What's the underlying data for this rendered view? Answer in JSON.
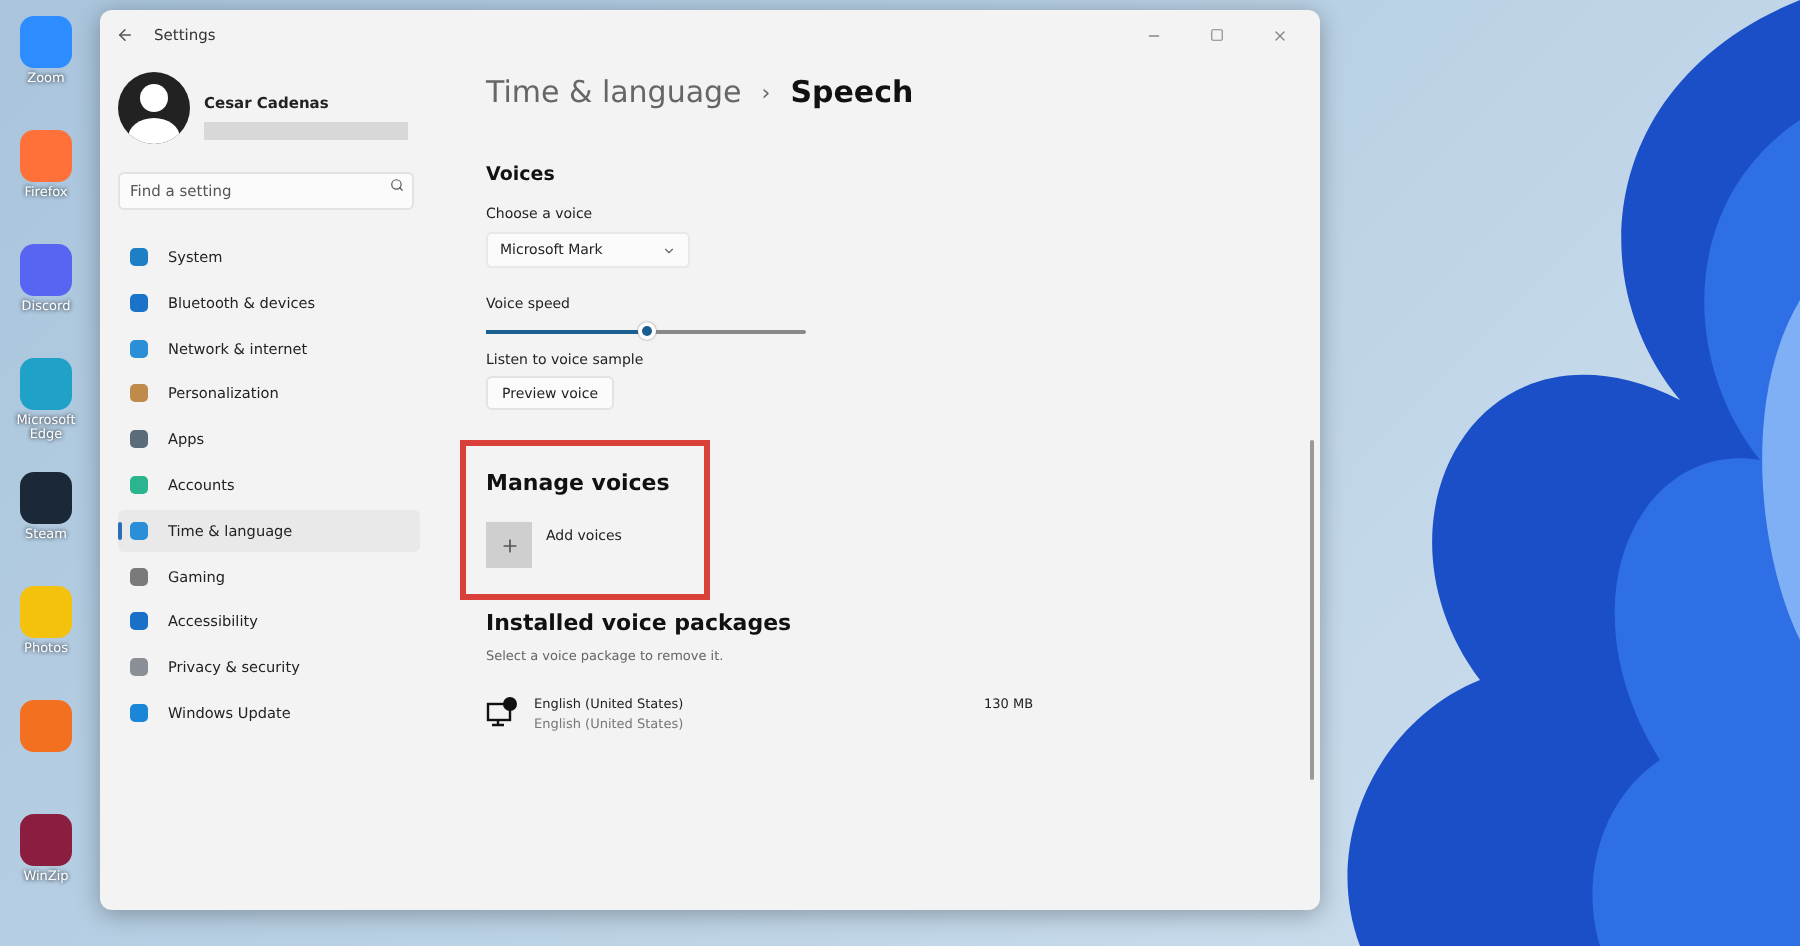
{
  "desktop": {
    "icons": [
      {
        "label": "Zoom",
        "color": "#2d8cff"
      },
      {
        "label": "Firefox",
        "color": "#ff7139"
      },
      {
        "label": "Discord",
        "color": "#5865f2"
      },
      {
        "label": "Microsoft Edge",
        "color": "#1fa1c8"
      },
      {
        "label": "Steam",
        "color": "#1b2838"
      },
      {
        "label": "Photos",
        "color": "#f4c20d"
      },
      {
        "color": "#f37021"
      },
      {
        "label": "WinZip",
        "color": "#8b1e3f"
      }
    ]
  },
  "window": {
    "title": "Settings"
  },
  "profile": {
    "name": "Cesar Cadenas"
  },
  "search": {
    "placeholder": "Find a setting"
  },
  "sidebar": {
    "items": [
      {
        "label": "System",
        "selected": false,
        "color": "#1f7fc4"
      },
      {
        "label": "Bluetooth & devices",
        "selected": false,
        "color": "#1a73c8"
      },
      {
        "label": "Network & internet",
        "selected": false,
        "color": "#2a8fd6"
      },
      {
        "label": "Personalization",
        "selected": false,
        "color": "#c08a4a"
      },
      {
        "label": "Apps",
        "selected": false,
        "color": "#5a6b7a"
      },
      {
        "label": "Accounts",
        "selected": false,
        "color": "#2bb58f"
      },
      {
        "label": "Time & language",
        "selected": true,
        "color": "#2a8fd6"
      },
      {
        "label": "Gaming",
        "selected": false,
        "color": "#7a7a7a"
      },
      {
        "label": "Accessibility",
        "selected": false,
        "color": "#1a6fc8"
      },
      {
        "label": "Privacy & security",
        "selected": false,
        "color": "#8a8f96"
      },
      {
        "label": "Windows Update",
        "selected": false,
        "color": "#1a86d8"
      }
    ]
  },
  "breadcrumb": {
    "parent": "Time & language",
    "separator": "›",
    "current": "Speech"
  },
  "voices": {
    "heading": "Voices",
    "choose_label": "Choose a voice",
    "voice": "Microsoft Mark",
    "speed_label": "Voice speed",
    "speed": {
      "level": 0.5
    },
    "sample_label": "Listen to voice sample",
    "preview_button": "Preview voice"
  },
  "manage": {
    "heading": "Manage voices",
    "highlighted": true,
    "add_button": "Add voices"
  },
  "installed": {
    "heading": "Installed voice packages",
    "description": "Select a voice package to remove it.",
    "packages": [
      {
        "name": "English (United States)",
        "subtitle": "English (United States)",
        "size": "130 MB"
      }
    ]
  }
}
